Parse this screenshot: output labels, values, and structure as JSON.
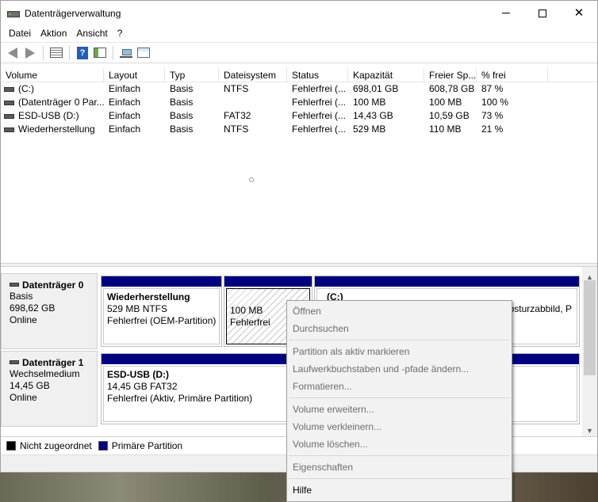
{
  "window": {
    "title": "Datenträgerverwaltung"
  },
  "menu": [
    "Datei",
    "Aktion",
    "Ansicht",
    "?"
  ],
  "toolbar": {
    "icons": [
      "back-arrow-icon",
      "forward-arrow-icon",
      "list-view-icon",
      "help-icon",
      "properties-icon",
      "connect-icon",
      "settings-icon"
    ],
    "help_glyph": "?"
  },
  "volume_table": {
    "columns": [
      "Volume",
      "Layout",
      "Typ",
      "Dateisystem",
      "Status",
      "Kapazität",
      "Freier Sp...",
      "% frei"
    ],
    "rows": [
      [
        "(C:)",
        "Einfach",
        "Basis",
        "NTFS",
        "Fehlerfrei (...",
        "698,01 GB",
        "608,78 GB",
        "87 %"
      ],
      [
        "(Datenträger 0 Par...",
        "Einfach",
        "Basis",
        "",
        "Fehlerfrei (...",
        "100 MB",
        "100 MB",
        "100 %"
      ],
      [
        "ESD-USB (D:)",
        "Einfach",
        "Basis",
        "FAT32",
        "Fehlerfrei (...",
        "14,43 GB",
        "10,59 GB",
        "73 %"
      ],
      [
        "Wiederherstellung",
        "Einfach",
        "Basis",
        "NTFS",
        "Fehlerfrei (...",
        "529 MB",
        "110 MB",
        "21 %"
      ]
    ]
  },
  "disks": [
    {
      "name": "Datenträger 0",
      "lines": [
        "Basis",
        "698,62 GB",
        "Online"
      ],
      "partitions": [
        {
          "name": "Wiederherstellung",
          "lines": [
            "529 MB NTFS",
            "Fehlerfrei (OEM-Partition)"
          ]
        },
        {
          "name": "",
          "lines": [
            "100 MB",
            "Fehlerfrei"
          ]
        },
        {
          "name": "(C:)",
          "lines": [
            "",
            "bsturzabbild, P"
          ]
        }
      ]
    },
    {
      "name": "Datenträger 1",
      "lines": [
        "Wechselmedium",
        "14,45 GB",
        "Online"
      ],
      "partitions": [
        {
          "name": "ESD-USB  (D:)",
          "lines": [
            "14,45 GB FAT32",
            "Fehlerfrei (Aktiv, Primäre Partition)"
          ]
        }
      ]
    }
  ],
  "legend": [
    {
      "label": "Nicht zugeordnet",
      "color": "#000000"
    },
    {
      "label": "Primäre Partition",
      "color": "#000080"
    }
  ],
  "context_menu": {
    "groups": [
      [
        "Öffnen",
        "Durchsuchen"
      ],
      [
        "Partition als aktiv markieren",
        "Laufwerkbuchstaben und -pfade ändern...",
        "Formatieren..."
      ],
      [
        "Volume erweitern...",
        "Volume verkleinern...",
        "Volume löschen..."
      ],
      [
        "Eigenschaften"
      ],
      [
        "Hilfe"
      ]
    ],
    "enabled": [
      "Hilfe"
    ]
  },
  "colors": {
    "primary_partition": "#000080",
    "unallocated": "#000000",
    "menu_bg": "#f2f2f2"
  }
}
